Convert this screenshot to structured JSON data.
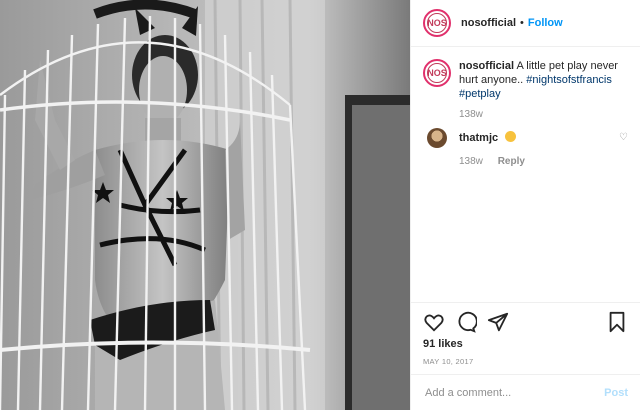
{
  "post": {
    "username": "nosofficial",
    "separator": "•",
    "follow_label": "Follow",
    "avatar_letters": "NOS",
    "caption_text": "A little pet play never hurt anyone..",
    "hashtags": [
      "#nightsofstfrancis",
      "#petplay"
    ],
    "caption_age": "138w",
    "comments": [
      {
        "username": "thatmjc",
        "emoji": "heart-eyes-emoji",
        "age": "138w",
        "reply_label": "Reply"
      }
    ],
    "likes": "91 likes",
    "date": "MAY 10, 2017",
    "comment_placeholder": "Add a comment...",
    "post_label": "Post"
  },
  "icons": {
    "like": "heart-icon",
    "comment": "comment-icon",
    "share": "share-icon",
    "save": "bookmark-icon",
    "comment_like": "small-heart-icon"
  },
  "colors": {
    "follow": "#0095f6",
    "hashtag": "#00376b",
    "muted": "#8e8e8e",
    "post_disabled": "#b2dffc",
    "avatar_ring": "#e1306c"
  }
}
